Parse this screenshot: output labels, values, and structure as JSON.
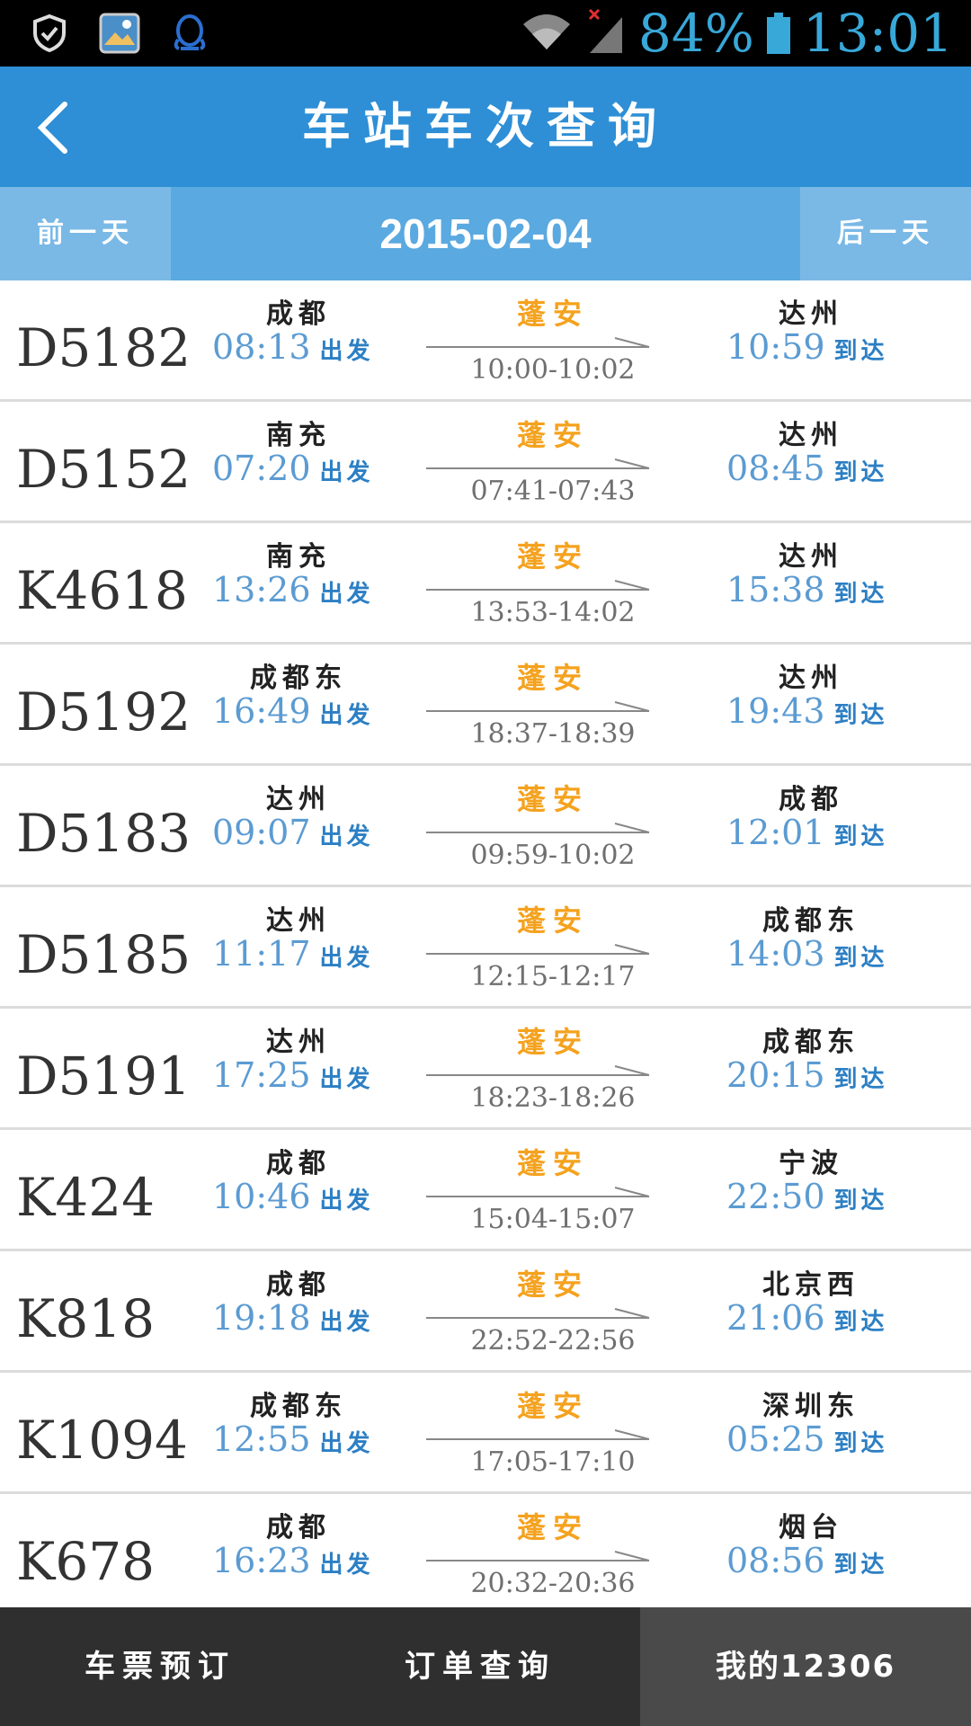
{
  "status_bar": {
    "battery_percent": "84%",
    "time": "13:01",
    "icons": [
      "shield-icon",
      "gallery-icon",
      "qq-icon",
      "wifi-icon",
      "signal-icon",
      "battery-icon"
    ]
  },
  "header": {
    "title": "车站车次查询"
  },
  "date_bar": {
    "prev_label": "前一天",
    "date": "2015-02-04",
    "next_label": "后一天"
  },
  "labels": {
    "depart": "出发",
    "arrive": "到达"
  },
  "trains": [
    {
      "number": "D5182",
      "from": "成都",
      "from_time": "08:13",
      "via": "蓬安",
      "via_time": "10:00-10:02",
      "to": "达州",
      "to_time": "10:59"
    },
    {
      "number": "D5152",
      "from": "南充",
      "from_time": "07:20",
      "via": "蓬安",
      "via_time": "07:41-07:43",
      "to": "达州",
      "to_time": "08:45"
    },
    {
      "number": "K4618",
      "from": "南充",
      "from_time": "13:26",
      "via": "蓬安",
      "via_time": "13:53-14:02",
      "to": "达州",
      "to_time": "15:38"
    },
    {
      "number": "D5192",
      "from": "成都东",
      "from_time": "16:49",
      "via": "蓬安",
      "via_time": "18:37-18:39",
      "to": "达州",
      "to_time": "19:43"
    },
    {
      "number": "D5183",
      "from": "达州",
      "from_time": "09:07",
      "via": "蓬安",
      "via_time": "09:59-10:02",
      "to": "成都",
      "to_time": "12:01"
    },
    {
      "number": "D5185",
      "from": "达州",
      "from_time": "11:17",
      "via": "蓬安",
      "via_time": "12:15-12:17",
      "to": "成都东",
      "to_time": "14:03"
    },
    {
      "number": "D5191",
      "from": "达州",
      "from_time": "17:25",
      "via": "蓬安",
      "via_time": "18:23-18:26",
      "to": "成都东",
      "to_time": "20:15"
    },
    {
      "number": "K424",
      "from": "成都",
      "from_time": "10:46",
      "via": "蓬安",
      "via_time": "15:04-15:07",
      "to": "宁波",
      "to_time": "22:50"
    },
    {
      "number": "K818",
      "from": "成都",
      "from_time": "19:18",
      "via": "蓬安",
      "via_time": "22:52-22:56",
      "to": "北京西",
      "to_time": "21:06"
    },
    {
      "number": "K1094",
      "from": "成都东",
      "from_time": "12:55",
      "via": "蓬安",
      "via_time": "17:05-17:10",
      "to": "深圳东",
      "to_time": "05:25"
    },
    {
      "number": "K678",
      "from": "成都",
      "from_time": "16:23",
      "via": "蓬安",
      "via_time": "20:32-20:36",
      "to": "烟台",
      "to_time": "08:56"
    }
  ],
  "bottom_nav": {
    "tickets": "车票预订",
    "orders": "订单查询",
    "mine": "我的12306"
  },
  "colors": {
    "header_blue": "#2e8fd6",
    "date_bar": "#5aa9e0",
    "time_blue": "#5b9bd2",
    "via_orange": "#f5a21e",
    "nav_dark": "#2f2f2f"
  }
}
